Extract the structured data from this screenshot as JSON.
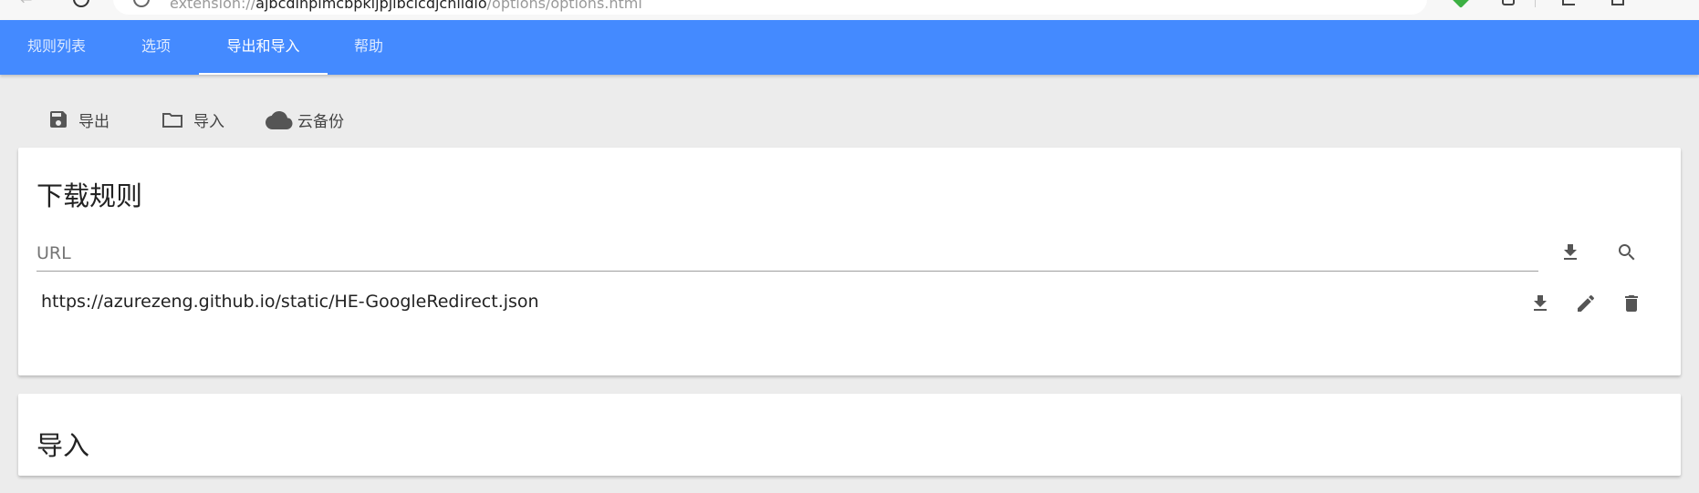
{
  "browser": {
    "address_scheme": "extension://",
    "address_host": "ajbcdlnplmcbpkljpjibcicdjcnlidio",
    "address_path": "/options/options.html"
  },
  "nav": {
    "tabs": [
      {
        "label": "规则列表",
        "active": false
      },
      {
        "label": "选项",
        "active": false
      },
      {
        "label": "导出和导入",
        "active": true
      },
      {
        "label": "帮助",
        "active": false
      }
    ],
    "accent_color": "#448aff"
  },
  "toolbar": {
    "export_label": "导出",
    "import_label": "导入",
    "cloud_backup_label": "云备份"
  },
  "download_rules": {
    "title": "下载规则",
    "url_input": {
      "value": "",
      "placeholder": "URL"
    },
    "rules": [
      {
        "url": "https://azurezeng.github.io/static/HE-GoogleRedirect.json"
      }
    ]
  },
  "import_section": {
    "title": "导入"
  },
  "icons": [
    "save-icon",
    "folder-icon",
    "cloud-icon",
    "download-icon",
    "search-icon",
    "edit-icon",
    "delete-icon"
  ]
}
